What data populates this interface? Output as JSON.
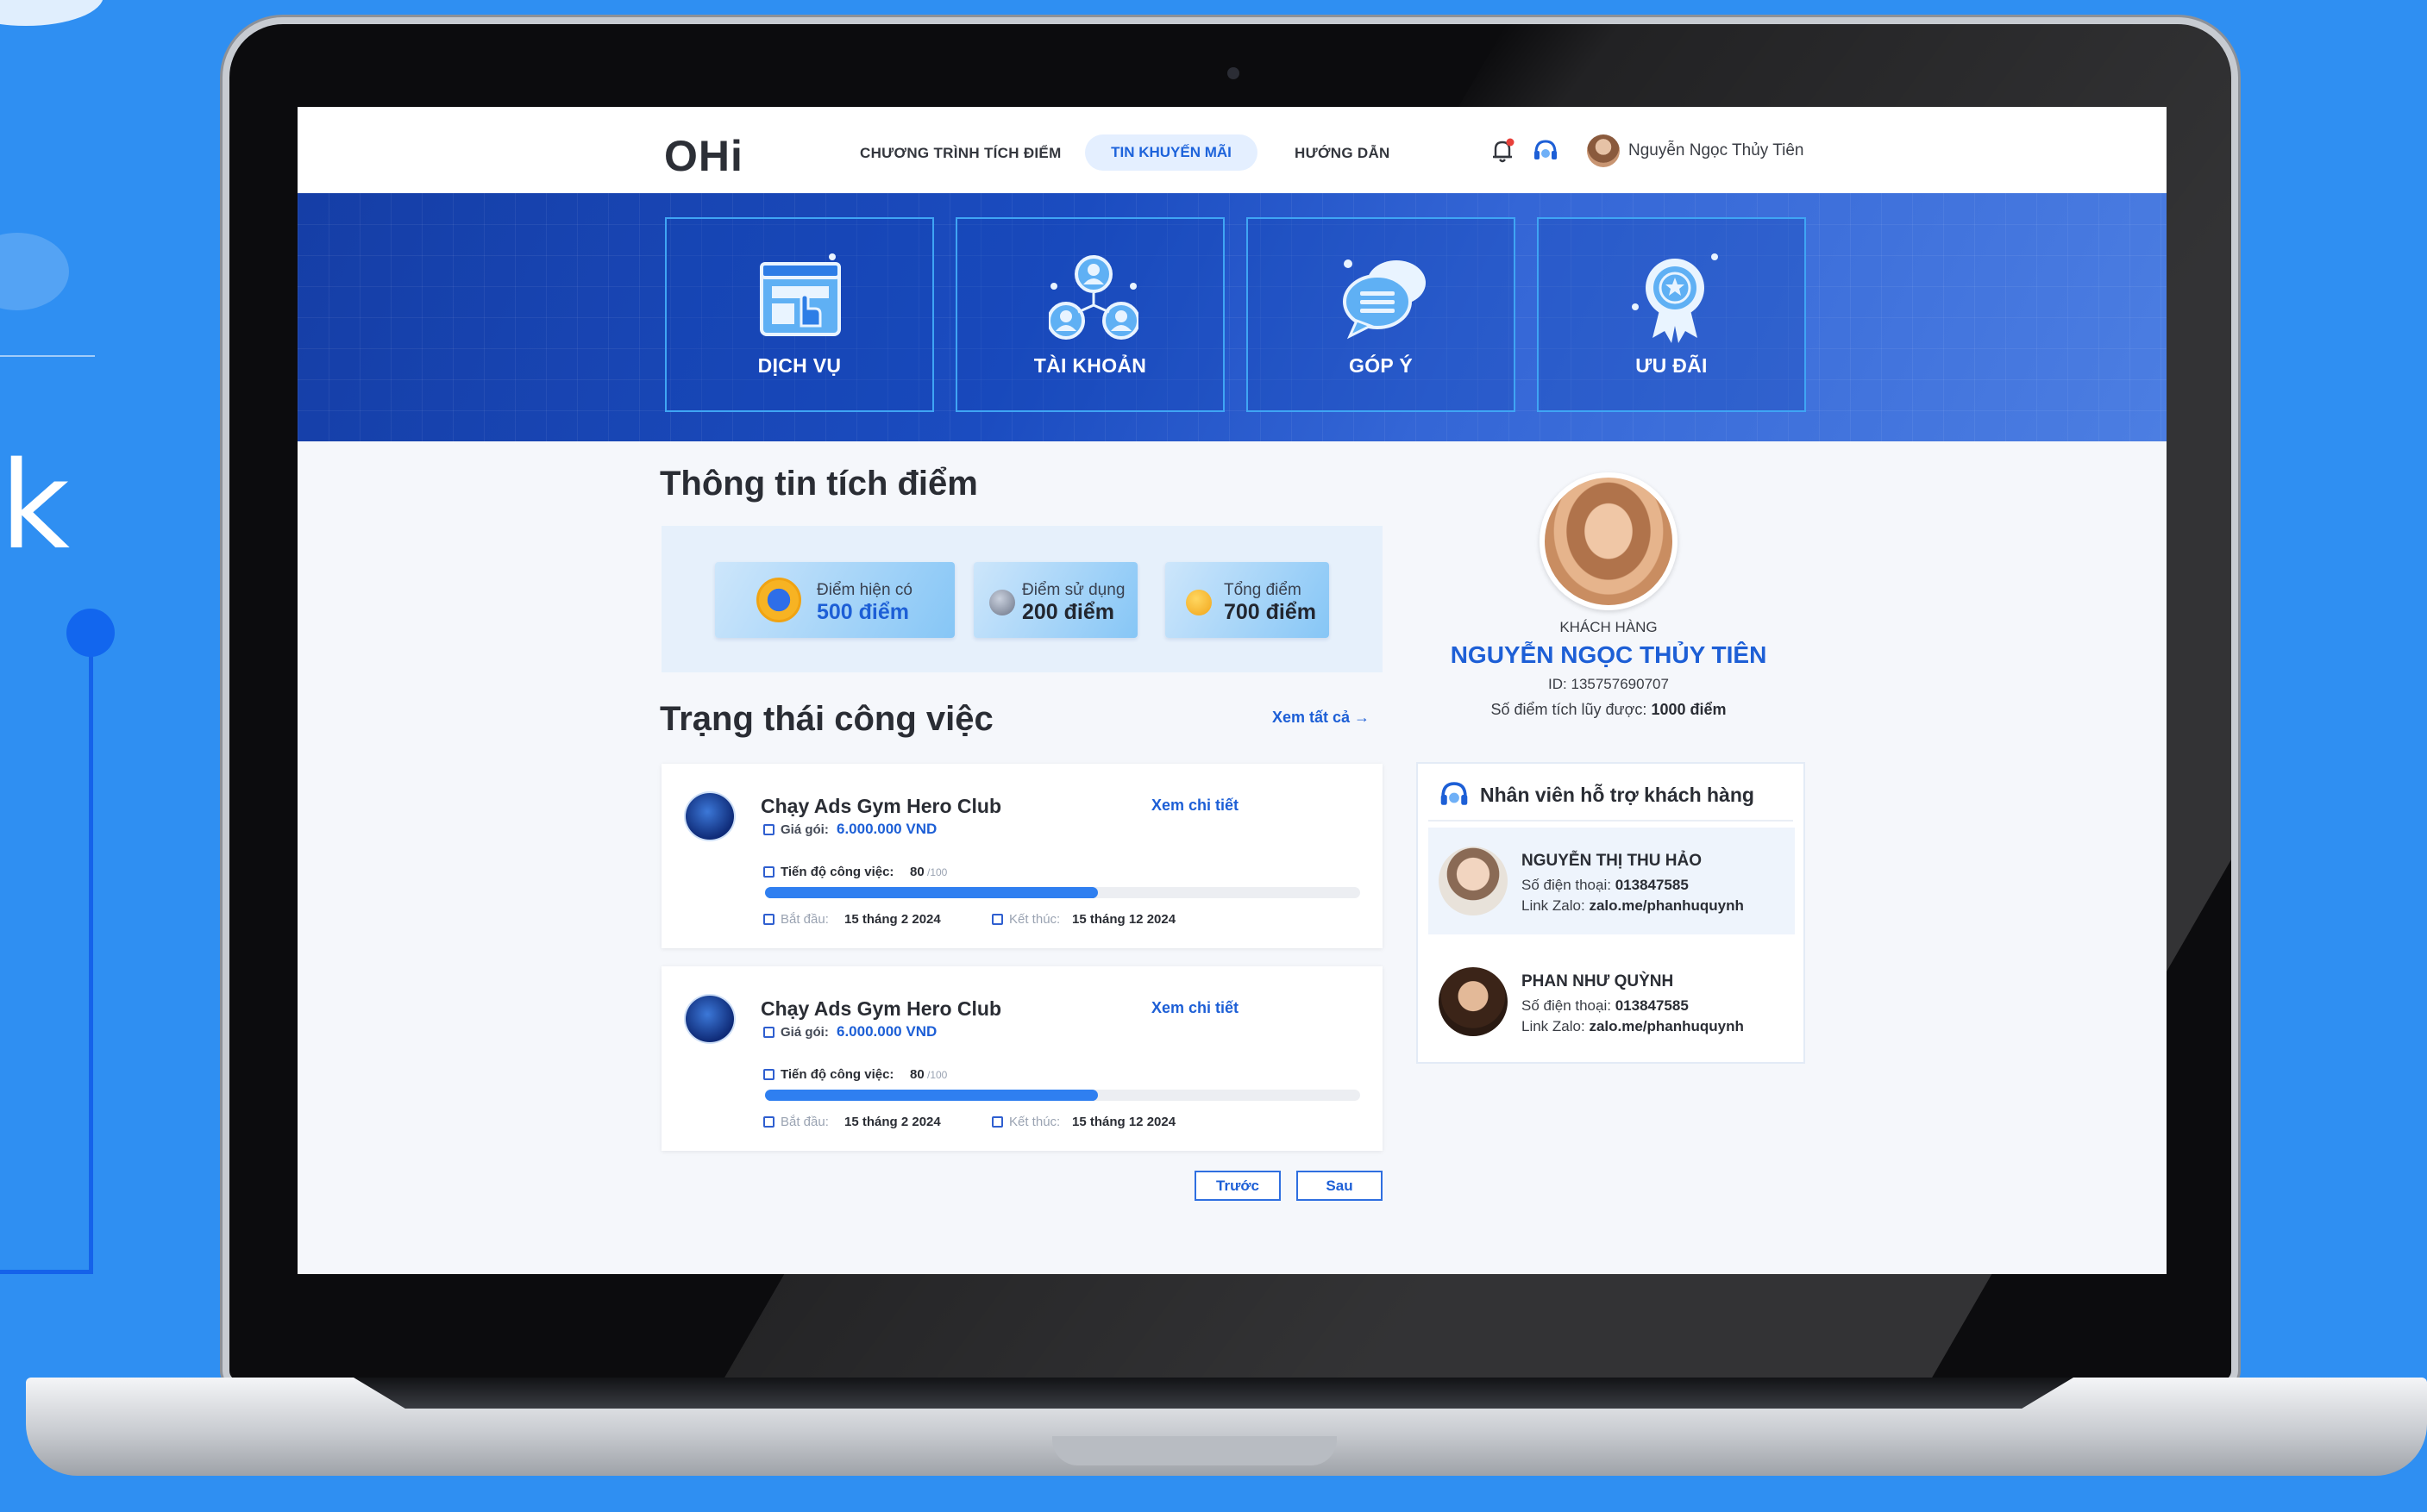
{
  "background": {
    "letter": "k"
  },
  "colors": {
    "accent": "#1d5fd6",
    "background": "#2f8ff2",
    "banner": "#1b4cc0"
  },
  "header": {
    "logo": "OHi",
    "nav": [
      "CHƯƠNG TRÌNH TÍCH ĐIỂM",
      "TIN KHUYẾN MÃI",
      "HƯỚNG DẪN"
    ],
    "active_nav": "TIN KHUYẾN MÃI",
    "icons": [
      "bell-icon",
      "headset-icon"
    ],
    "user_name": "Nguyễn Ngọc Thủy Tiên"
  },
  "banner": {
    "tiles": [
      {
        "label": "DỊCH VỤ",
        "icon": "service-icon"
      },
      {
        "label": "TÀI KHOẢN",
        "icon": "account-network-icon"
      },
      {
        "label": "GÓP Ý",
        "icon": "feedback-chat-icon"
      },
      {
        "label": "ƯU ĐÃI",
        "icon": "badge-star-icon"
      }
    ]
  },
  "points": {
    "title": "Thông tin tích điểm",
    "cards": [
      {
        "label": "Điểm hiện có",
        "value": "500 điểm"
      },
      {
        "label": "Điểm sử dụng",
        "value": "200 điểm"
      },
      {
        "label": "Tổng điểm",
        "value": "700 điểm"
      }
    ]
  },
  "jobs": {
    "title": "Trạng thái công việc",
    "see_all": "Xem tất cả →",
    "items": [
      {
        "name": "Chạy Ads Gym Hero Club",
        "detail_link": "Xem chi tiết",
        "price_label": "Giá gói:",
        "price": "6.000.000 VND",
        "progress_label": "Tiến độ công việc:",
        "progress": "80",
        "progress_max": "/100",
        "start_label": "Bắt đầu:",
        "start": "15 tháng 2 2024",
        "end_label": "Kết thúc:",
        "end": "15 tháng 12 2024"
      },
      {
        "name": "Chạy Ads Gym Hero Club",
        "detail_link": "Xem chi tiết",
        "price_label": "Giá gói:",
        "price": "6.000.000 VND",
        "progress_label": "Tiến độ công việc:",
        "progress": "80",
        "progress_max": "/100",
        "start_label": "Bắt đầu:",
        "start": "15 tháng 2 2024",
        "end_label": "Kết thúc:",
        "end": "15 tháng 12 2024"
      }
    ],
    "pagination": {
      "prev": "Trước",
      "next": "Sau"
    }
  },
  "profile": {
    "role": "KHÁCH HÀNG",
    "name": "NGUYỄN NGỌC THỦY TIÊN",
    "id": "ID: 135757690707",
    "points_label": "Số điểm tích lũy được:",
    "points_value": "1000 điểm"
  },
  "support": {
    "title": "Nhân viên hỗ trợ khách hàng",
    "staff": [
      {
        "name": "NGUYỄN THỊ THU HẢO",
        "phone_label": "Số điện thoại:",
        "phone": "013847585",
        "zalo_label": "Link Zalo:",
        "zalo": "zalo.me/phanhuquynh"
      },
      {
        "name": "PHAN NHƯ QUỲNH",
        "phone_label": "Số điện thoại:",
        "phone": "013847585",
        "zalo_label": "Link Zalo:",
        "zalo": "zalo.me/phanhuquynh"
      }
    ]
  }
}
